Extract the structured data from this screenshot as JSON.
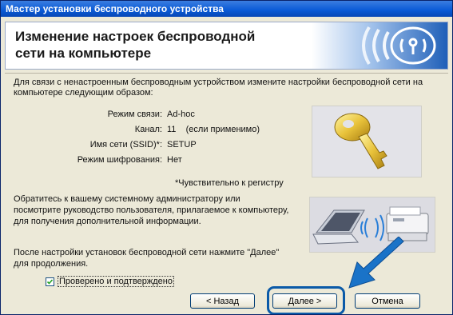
{
  "window": {
    "title": "Мастер установки беспроводного устройства"
  },
  "header": {
    "title_line1": "Изменение настроек беспроводной",
    "title_line2": "сети на компьютере"
  },
  "intro": "Для связи с ненастроенным беспроводным устройством измените настройки беспроводной сети на компьютере следующим образом:",
  "settings": [
    {
      "label": "Режим связи:",
      "value": "Ad-hoc"
    },
    {
      "label": "Канал:",
      "value": "11    (если применимо)"
    },
    {
      "label": "Имя сети (SSID)*:",
      "value": "SETUP"
    },
    {
      "label": "Режим шифрования:",
      "value": "Нет"
    }
  ],
  "note": "*Чувствительно к регистру",
  "info": "Обратитесь к вашему системному администратору или посмотрите руководство пользователя, прилагаемое к компьютеру, для получения дополнительной информации.",
  "after": "После настройки установок беспроводной сети нажмите \"Далее\" для продолжения.",
  "checkbox": {
    "label": "Проверено и подтверждено",
    "checked": true
  },
  "buttons": {
    "back": "< Назад",
    "next": "Далее >",
    "cancel": "Отмена"
  },
  "colors": {
    "titlebar": "#0a5ad6",
    "highlight": "#0b5aa8",
    "arrow": "#1a73c8"
  }
}
